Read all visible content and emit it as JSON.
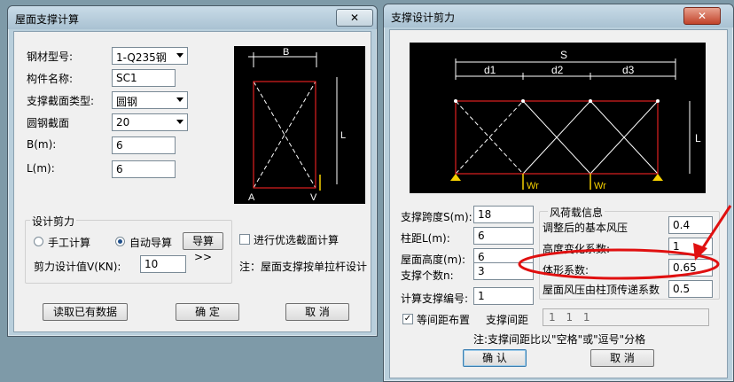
{
  "win1": {
    "title": "屋面支撑计算",
    "close": "✕",
    "steel_label": "钢材型号:",
    "steel_value": "1-Q235钢",
    "name_label": "构件名称:",
    "name_value": "SC1",
    "section_type_label": "支撑截面类型:",
    "section_type_value": "圆钢",
    "round_label": "圆钢截面",
    "round_value": "20",
    "b_label": "B(m):",
    "b_value": "6",
    "l_label": "L(m):",
    "l_value": "6",
    "diagram": {
      "B": "B",
      "L": "L",
      "A": "A",
      "V": "V"
    },
    "shear_group": "设计剪力",
    "manual": "手工计算",
    "auto": "自动导算",
    "calc_btn": "导算>>",
    "shear_label": "剪力设计值V(KN):",
    "shear_value": "10",
    "opt_check": "进行优选截面计算",
    "note": "注：屋面支撑按单拉杆设计",
    "read_btn": "读取已有数据",
    "ok_btn": "确 定",
    "cancel_btn": "取 消"
  },
  "win2": {
    "title": "支撑设计剪力",
    "close": "✕",
    "diagram": {
      "S": "S",
      "d1": "d1",
      "d2": "d2",
      "d3": "d3",
      "L": "L",
      "Wr1": "Wr",
      "Wr2": "Wr"
    },
    "span_label": "支撑跨度S(m):",
    "span_value": "18",
    "col_label": "柱距L(m):",
    "col_value": "6",
    "roof_label": "屋面高度(m):",
    "roof_value": "6",
    "count_label": "支撑个数n:",
    "count_value": "3",
    "num_label": "计算支撑编号:",
    "num_value": "1",
    "wind_group": "风荷载信息",
    "pressure_label": "调整后的基本风压",
    "pressure_value": "0.4",
    "height_label": "高度变化系数:",
    "height_value": "1",
    "shape_label": "体形系数:",
    "shape_value": "0.65",
    "hidden_label": "屋面风压由柱顶传递系数",
    "hidden_value": "0.5",
    "equal_check": "等间距布置",
    "spacing_label": "支撑间距",
    "spacing_value": "1 1 1",
    "note": "注:支撑间距比以\"空格\"或\"逗号\"分格",
    "ok_btn": "确 认",
    "cancel_btn": "取 消"
  },
  "colors": {
    "red": "#e02020",
    "annotation": "#e01010"
  }
}
